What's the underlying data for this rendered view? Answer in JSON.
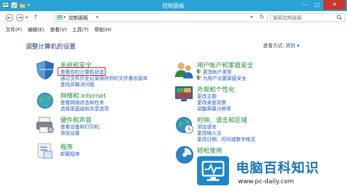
{
  "window": {
    "title": "控制面板",
    "minimize": "—",
    "maximize": "□",
    "close": "✕"
  },
  "address": {
    "breadcrumb": "控制面板",
    "search_placeholder": "搜索控制面板"
  },
  "menu": [
    "文件(F)",
    "编辑(E)",
    "查看(V)",
    "工具(T)",
    "帮助(H)"
  ],
  "main": {
    "heading": "调整计算机的设置",
    "view_by_label": "查看方式:",
    "view_by_value": "类别 ▾"
  },
  "categories": {
    "system": {
      "title": "系统和安全",
      "links": [
        "查看你的计算机状态",
        "通过文件历史记录保存你的文件备份副本",
        "查找并解决问题"
      ]
    },
    "network": {
      "title": "网络和 Internet",
      "links": [
        "查看网络状态和任务",
        "选择家庭组和共享选项"
      ]
    },
    "hardware": {
      "title": "硬件和声音",
      "links": [
        "查看设备和打印机",
        "添加设备"
      ]
    },
    "programs": {
      "title": "程序",
      "links": [
        "卸载程序"
      ]
    },
    "user": {
      "title": "用户帐户和家庭安全",
      "links": [
        "更改帐户类型",
        "为用户设置家庭安全"
      ]
    },
    "appearance": {
      "title": "外观和个性化",
      "links": [
        "更改主题",
        "更改桌面背景",
        "调整屏幕分辨率"
      ]
    },
    "clock": {
      "title": "时钟、语言和区域",
      "links": [
        "添加语言",
        "更改输入法",
        "更改日期、时间或数字格式"
      ]
    },
    "ease": {
      "title": "轻松使用",
      "links": []
    }
  },
  "watermark": {
    "title": "电脑百科知识",
    "url": "www.pc-daily.com"
  }
}
